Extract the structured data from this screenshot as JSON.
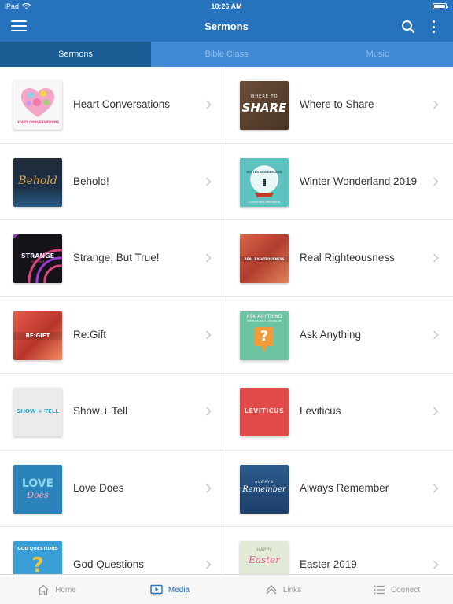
{
  "status_bar": {
    "device": "iPad",
    "time": "10:26 AM"
  },
  "nav": {
    "title": "Sermons"
  },
  "tabs": [
    {
      "label": "Sermons",
      "active": true
    },
    {
      "label": "Bible Class",
      "active": false
    },
    {
      "label": "Music",
      "active": false
    }
  ],
  "thumb_text": {
    "heart": "HEART CONVERSATIONS",
    "share_top": "WHERE TO",
    "share_big": "SHARE",
    "behold": "Behold",
    "winter_top": "WINTER WONDERLAND",
    "winter_bottom": "A CHRISTMAS MEDITATION",
    "strange": "STRANGE",
    "strange_sub": "BUT TRUE",
    "real": "REAL RIGHTEOUSNESS",
    "regift": "RE:GIFT",
    "ask_top": "ASK ANYTHING",
    "ask_sub": "QUESTIONS ABOUT FAITH AND LIFE",
    "ask_mark": "?",
    "show": "SHOW + TELL",
    "lev": "LEVITICUS",
    "love_top": "LOVE",
    "love_bottom": "Does",
    "always_top": "ALWAYS",
    "always_bottom": "Remember",
    "godq": "GOD QUESTIONS",
    "godq_mark": "?",
    "easter_top": "HAPPY",
    "easter_bottom": "Easter"
  },
  "sermons": [
    [
      "Heart Conversations",
      "Where to Share"
    ],
    [
      "Behold!",
      "Winter Wonderland 2019"
    ],
    [
      "Strange, But True!",
      "Real Righteousness"
    ],
    [
      "Re:Gift",
      "Ask Anything"
    ],
    [
      "Show + Tell",
      "Leviticus"
    ],
    [
      "Love Does",
      "Always Remember"
    ],
    [
      "God Questions",
      "Easter 2019"
    ]
  ],
  "bottom_bar": [
    {
      "label": "Home",
      "icon": "home-icon",
      "active": false
    },
    {
      "label": "Media",
      "icon": "media-icon",
      "active": true
    },
    {
      "label": "Links",
      "icon": "links-icon",
      "active": false
    },
    {
      "label": "Connect",
      "icon": "list-icon",
      "active": false
    }
  ],
  "colors": {
    "primary": "#2672bd",
    "tab_bar": "#4189d2",
    "active_tab": "#1b5b93"
  }
}
